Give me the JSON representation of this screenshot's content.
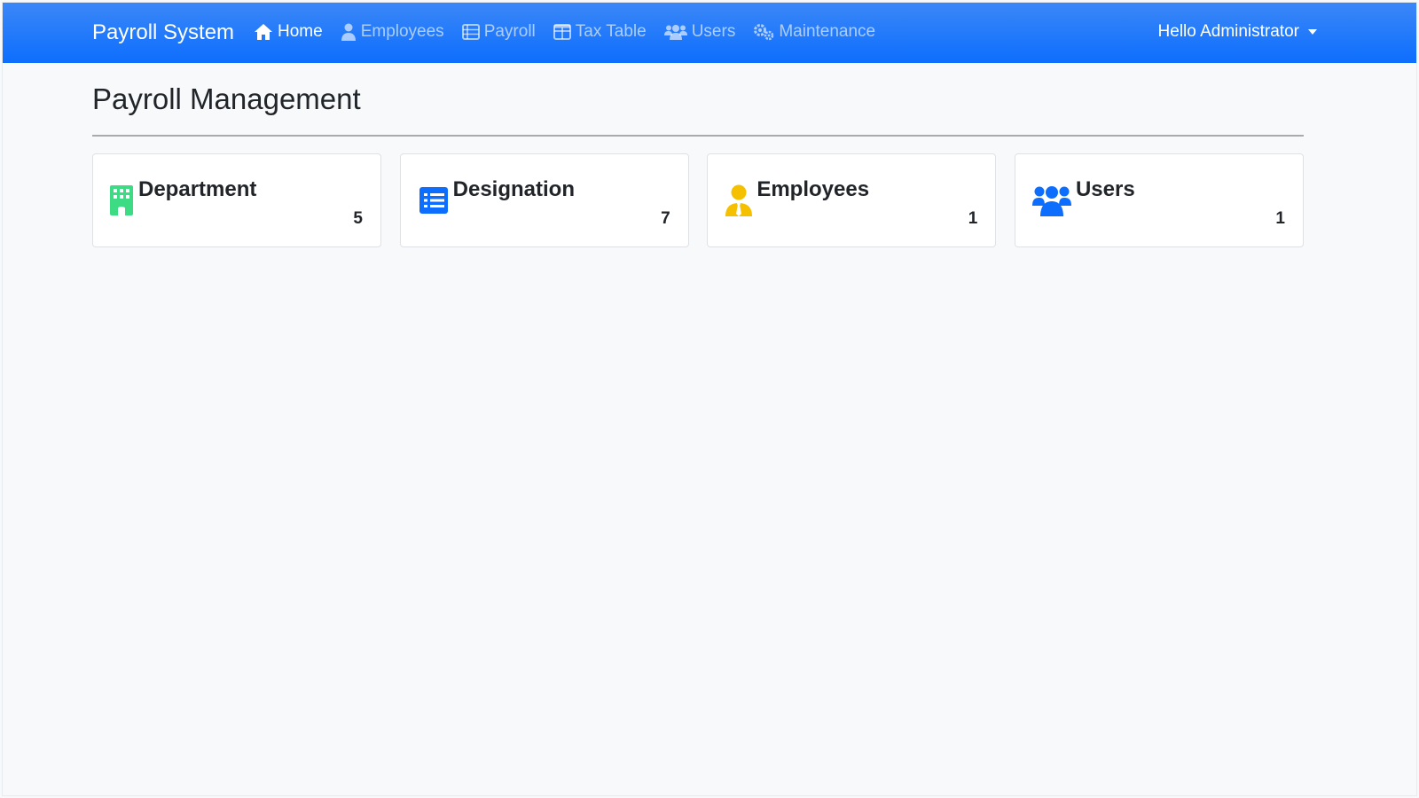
{
  "navbar": {
    "brand": "Payroll System",
    "items": [
      {
        "label": "Home",
        "icon": "home-icon",
        "active": true
      },
      {
        "label": "Employees",
        "icon": "user-tie-icon",
        "active": false
      },
      {
        "label": "Payroll",
        "icon": "table-list-icon",
        "active": false
      },
      {
        "label": "Tax Table",
        "icon": "table-icon",
        "active": false
      },
      {
        "label": "Users",
        "icon": "users-icon",
        "active": false
      },
      {
        "label": "Maintenance",
        "icon": "gears-icon",
        "active": false
      }
    ],
    "user_menu": "Hello Administrator"
  },
  "page": {
    "title": "Payroll Management"
  },
  "cards": [
    {
      "title": "Department",
      "count": "5",
      "icon": "building-icon",
      "color": "#3ddc84"
    },
    {
      "title": "Designation",
      "count": "7",
      "icon": "list-icon",
      "color": "#0d6efd"
    },
    {
      "title": "Employees",
      "count": "1",
      "icon": "user-tie-icon",
      "color": "#f5c000"
    },
    {
      "title": "Users",
      "count": "1",
      "icon": "users-icon",
      "color": "#0d6efd"
    }
  ],
  "colors": {
    "navbar": "#0d6efd",
    "background": "#f8f9fa"
  }
}
